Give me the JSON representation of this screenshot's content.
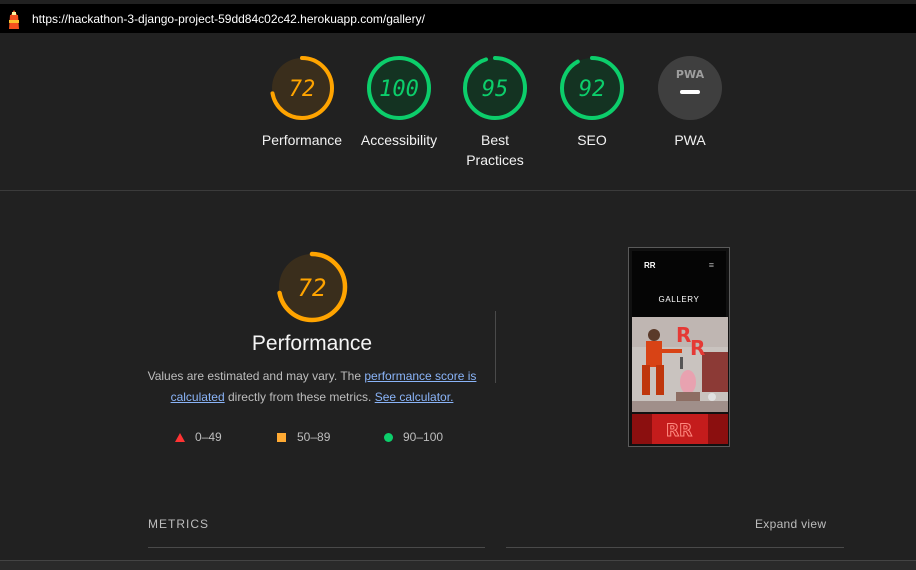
{
  "url_bar": {
    "url": "https://hackathon-3-django-project-59dd84c02c42.herokuapp.com/gallery/",
    "icon": "lighthouse-icon"
  },
  "gauges": [
    {
      "score": "72",
      "label": "Performance",
      "fraction": 0.72,
      "status": "average",
      "color": "#ffa400"
    },
    {
      "score": "100",
      "label": "Accessibility",
      "fraction": 1.0,
      "status": "pass",
      "color": "#0cce6b"
    },
    {
      "score": "95",
      "label": "Best Practices",
      "fraction": 0.95,
      "status": "pass",
      "color": "#0cce6b"
    },
    {
      "score": "92",
      "label": "SEO",
      "fraction": 0.92,
      "status": "pass",
      "color": "#0cce6b"
    },
    {
      "badge": "PWA",
      "label": "PWA",
      "status": "not-applicable"
    }
  ],
  "performance": {
    "score": "72",
    "fraction": 0.72,
    "title": "Performance",
    "desc_prefix": "Values are estimated and may vary. The ",
    "link1": "performance score is calculated",
    "desc_mid": " directly from these metrics. ",
    "link2": "See calculator."
  },
  "legend": {
    "fail": "0–49",
    "average": "50–89",
    "pass": "90–100"
  },
  "screenshot": {
    "brand": "RR",
    "menu_icon": "hamburger-icon",
    "title": "GALLERY"
  },
  "metrics": {
    "title": "METRICS",
    "expand": "Expand view"
  },
  "colors": {
    "pass": "#0cce6b",
    "average": "#ffa400",
    "fail": "#ff3333",
    "link": "#8ab4f8"
  }
}
